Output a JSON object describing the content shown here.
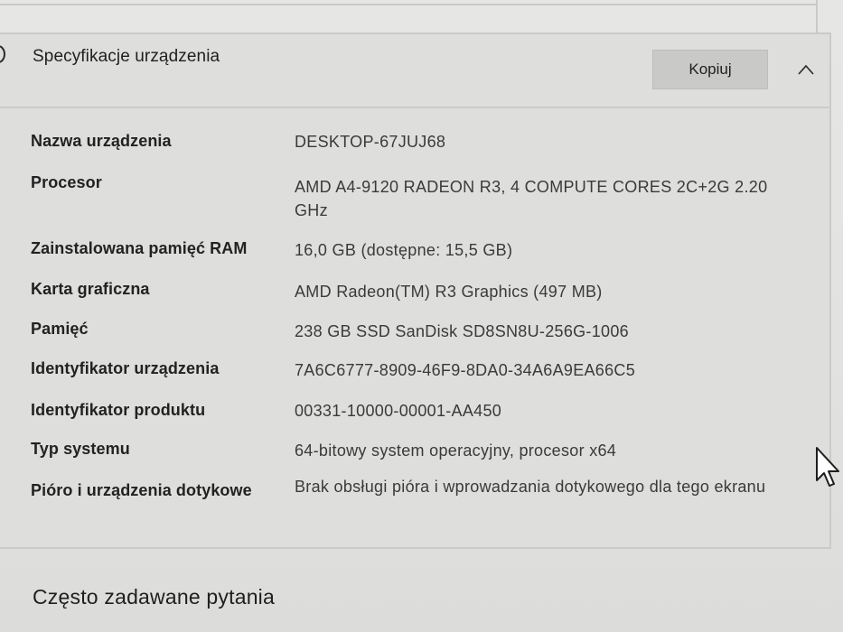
{
  "section": {
    "title": "Specyfikacje urządzenia",
    "copy_label": "Kopiuj",
    "collapse_icon": "chevron-up-icon"
  },
  "specs": [
    {
      "label": "Nazwa urządzenia",
      "value": "DESKTOP-67JUJ68"
    },
    {
      "label": "Procesor",
      "value": "AMD A4-9120 RADEON R3, 4 COMPUTE CORES 2C+2G 2.20 GHz"
    },
    {
      "label": "Zainstalowana pamięć RAM",
      "value": "16,0 GB (dostępne: 15,5 GB)"
    },
    {
      "label": "Karta graficzna",
      "value": "AMD Radeon(TM) R3 Graphics (497 MB)"
    },
    {
      "label": "Pamięć",
      "value": "238 GB SSD SanDisk SD8SN8U-256G-1006"
    },
    {
      "label": "Identyfikator urządzenia",
      "value": "7A6C6777-8909-46F9-8DA0-34A6A9EA66C5"
    },
    {
      "label": "Identyfikator produktu",
      "value": "00331-10000-00001-AA450"
    },
    {
      "label": "Typ systemu",
      "value": "64-bitowy system operacyjny, procesor x64"
    },
    {
      "label": "Pióro i urządzenia dotykowe",
      "value": "Brak obsługi pióra i wprowadzania dotykowego dla tego ekranu"
    }
  ],
  "faq": {
    "title": "Często zadawane pytania"
  }
}
